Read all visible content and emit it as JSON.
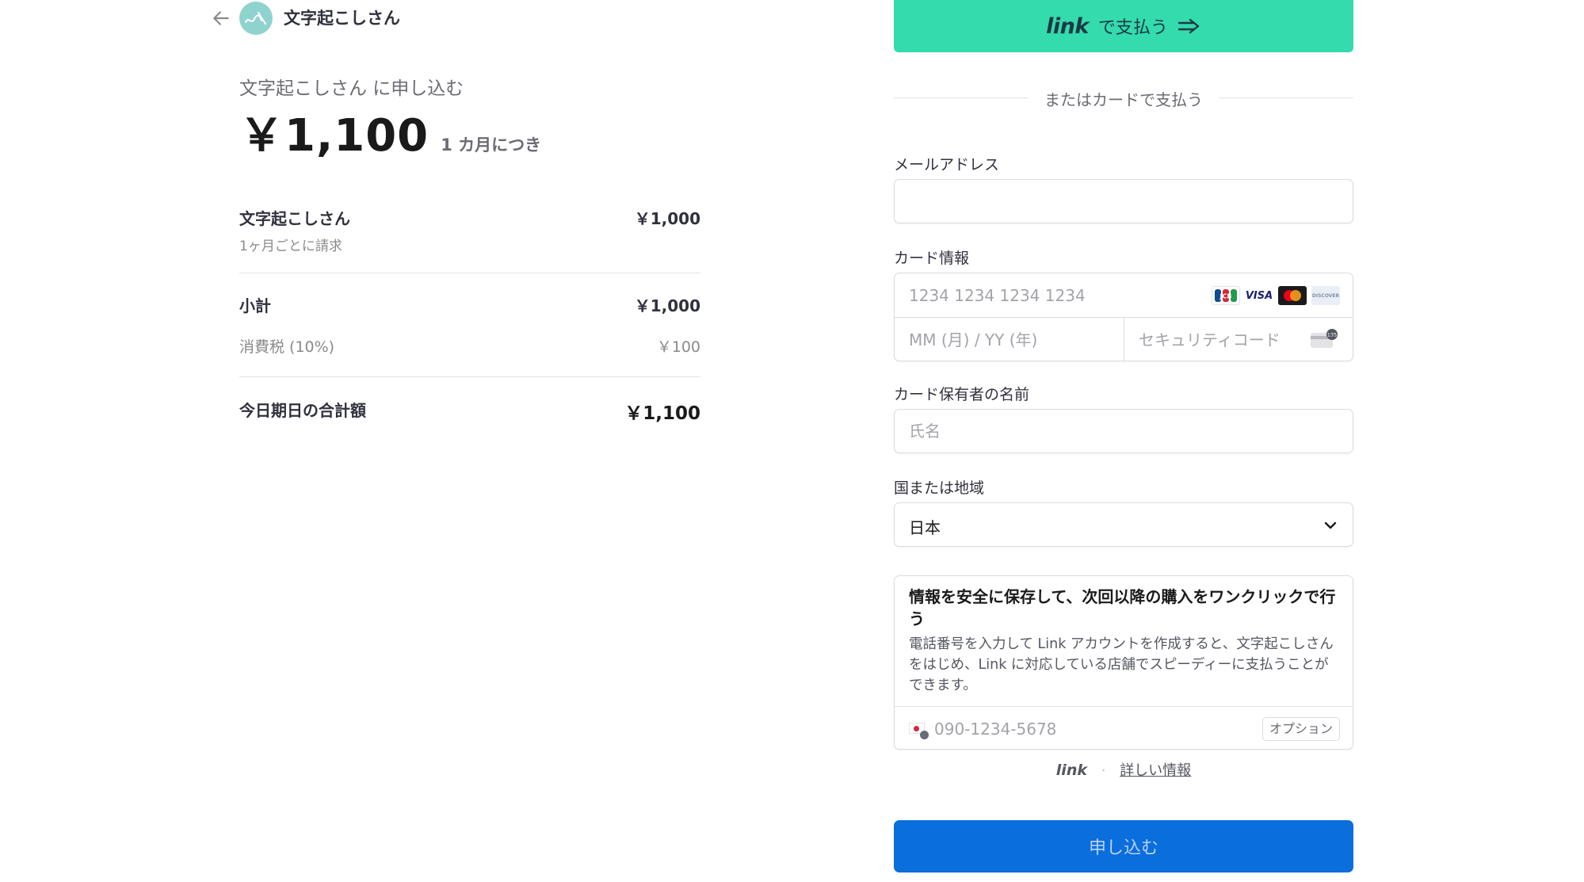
{
  "header": {
    "back_icon": "arrow-left-icon",
    "avatar_icon": "merchant-logo",
    "merchant_name": "文字起こしさん"
  },
  "summary": {
    "subscribe_title": "文字起こしさん に申し込む",
    "price": "￥1,100",
    "period": "1 カ月につき",
    "item": {
      "name": "文字起こしさん",
      "price": "￥1,000",
      "billing": "1ヶ月ごとに請求"
    },
    "subtotal": {
      "label": "小計",
      "value": "￥1,000"
    },
    "tax": {
      "label": "消費税 (10%)",
      "value": "￥100"
    },
    "total": {
      "label": "今日期日の合計額",
      "value": "￥1,100"
    }
  },
  "link_button": {
    "logo": "link",
    "label": "で支払う",
    "icon": "link-arrow-icon"
  },
  "or_divider": "またはカードで支払う",
  "email": {
    "label": "メールアドレス",
    "value": "",
    "placeholder": ""
  },
  "card": {
    "label": "カード情報",
    "number_placeholder": "1234 1234 1234 1234",
    "expiry_placeholder": "MM (月) / YY (年)",
    "cvc_placeholder": "セキュリティコード",
    "brands": [
      "JCB",
      "VISA",
      "Mastercard",
      "DISCOVER"
    ],
    "brand_labels": {
      "jcb": "JCB",
      "visa": "VISA",
      "discover": "DISCOVER"
    },
    "cvc_badge": "135"
  },
  "cardholder": {
    "label": "カード保有者の名前",
    "placeholder": "氏名"
  },
  "country": {
    "label": "国または地域",
    "value": "日本"
  },
  "save_info": {
    "title": "情報を安全に保存して、次回以降の購入をワンクリックで行う",
    "description": "電話番号を入力して Link アカウントを作成すると、文字起こしさん をはじめ、Link に対応している店舗でスピーディーに支払うことができます。",
    "phone_placeholder": "090-1234-5678",
    "optional_badge": "オプション"
  },
  "link_footer": {
    "logo": "link",
    "separator": "·",
    "more": "詳しい情報"
  },
  "submit": {
    "label": "申し込む"
  },
  "colors": {
    "link_green": "#33dbad",
    "submit_blue": "#0a6edd",
    "text_primary": "#1a1a1a",
    "text_muted": "#8a8a8a"
  }
}
